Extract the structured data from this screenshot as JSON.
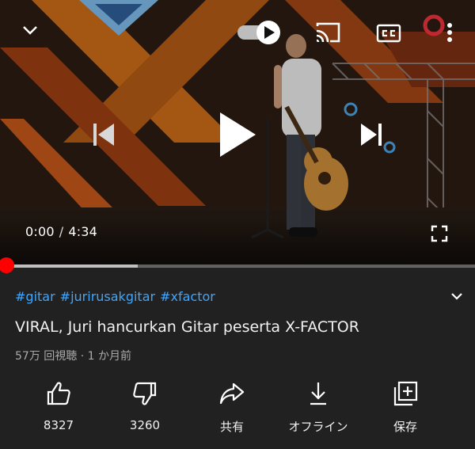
{
  "player": {
    "current_time": "0:00",
    "separator": "/",
    "duration": "4:34",
    "played_fraction": 0.0,
    "buffered_fraction": 0.29,
    "autoplay_on": true,
    "icons": {
      "minimize": "chevron-down-icon",
      "autoplay": "autoplay-toggle-icon",
      "cast": "cast-icon",
      "captions": "captions-icon",
      "more": "more-vert-icon",
      "previous": "skip-previous-icon",
      "play": "play-icon",
      "next": "skip-next-icon",
      "fullscreen": "fullscreen-icon"
    }
  },
  "video": {
    "hashtags": [
      "#gitar",
      "#jurirusakgitar",
      "#xfactor"
    ],
    "title": "VIRAL, Juri hancurkan Gitar peserta X-FACTOR",
    "views": "57万 回視聴",
    "dot": "·",
    "age": "1 か月前"
  },
  "actions": [
    {
      "id": "like",
      "label": "8327",
      "icon": "thumb-up-icon"
    },
    {
      "id": "dislike",
      "label": "3260",
      "icon": "thumb-down-icon"
    },
    {
      "id": "share",
      "label": "共有",
      "icon": "share-icon"
    },
    {
      "id": "offline",
      "label": "オフライン",
      "icon": "download-icon"
    },
    {
      "id": "save",
      "label": "保存",
      "icon": "add-to-playlist-icon"
    }
  ],
  "colors": {
    "background": "#212121",
    "hashtag": "#3ea6ff",
    "meta_text": "#aaaaaa",
    "progress_played": "#ff0000"
  }
}
